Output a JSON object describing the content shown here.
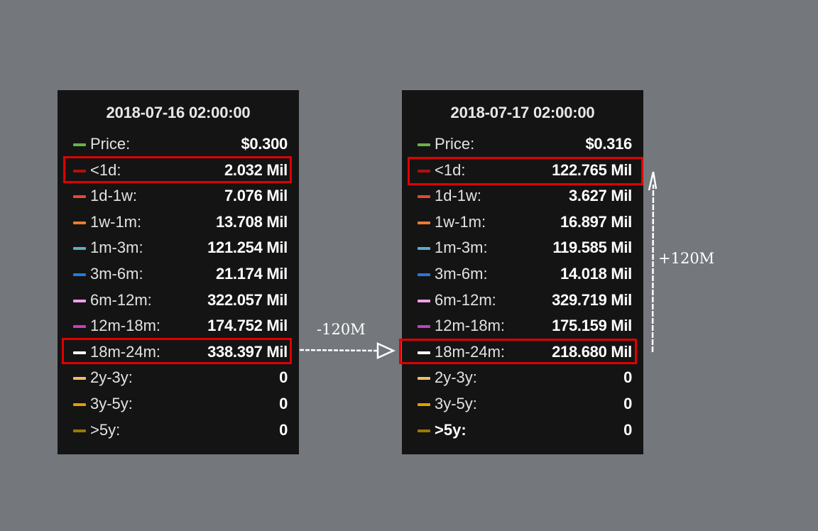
{
  "panels": [
    {
      "title": "2018-07-16 02:00:00",
      "rows": [
        {
          "label": "Price:",
          "value": "$0.300",
          "color": "#6ab04c"
        },
        {
          "label": "<1d:",
          "value": "2.032 Mil",
          "color": "#b01010"
        },
        {
          "label": "1d-1w:",
          "value": "7.076 Mil",
          "color": "#e04a3a"
        },
        {
          "label": "1w-1m:",
          "value": "13.708 Mil",
          "color": "#f07830"
        },
        {
          "label": "1m-3m:",
          "value": "121.254 Mil",
          "color": "#5aaed0"
        },
        {
          "label": "3m-6m:",
          "value": "21.174 Mil",
          "color": "#2a78d8"
        },
        {
          "label": "6m-12m:",
          "value": "322.057 Mil",
          "color": "#f0a0e8"
        },
        {
          "label": "12m-18m:",
          "value": "174.752 Mil",
          "color": "#c040c0"
        },
        {
          "label": "18m-24m:",
          "value": "338.397 Mil",
          "color": "#ffffff"
        },
        {
          "label": "2y-3y:",
          "value": "0",
          "color": "#f0c060"
        },
        {
          "label": "3y-5y:",
          "value": "0",
          "color": "#e0a000"
        },
        {
          "label": ">5y:",
          "value": "0",
          "color": "#9c7a00"
        }
      ]
    },
    {
      "title": "2018-07-17 02:00:00",
      "rows": [
        {
          "label": "Price:",
          "value": "$0.316",
          "color": "#6ab04c"
        },
        {
          "label": "<1d:",
          "value": "122.765 Mil",
          "color": "#b01010"
        },
        {
          "label": "1d-1w:",
          "value": "3.627 Mil",
          "color": "#e04a3a"
        },
        {
          "label": "1w-1m:",
          "value": "16.897 Mil",
          "color": "#f07830"
        },
        {
          "label": "1m-3m:",
          "value": "119.585 Mil",
          "color": "#5aaed0"
        },
        {
          "label": "3m-6m:",
          "value": "14.018 Mil",
          "color": "#2a78d8"
        },
        {
          "label": "6m-12m:",
          "value": "329.719 Mil",
          "color": "#f0a0e8"
        },
        {
          "label": "12m-18m:",
          "value": "175.159 Mil",
          "color": "#c040c0"
        },
        {
          "label": "18m-24m:",
          "value": "218.680 Mil",
          "color": "#ffffff"
        },
        {
          "label": "2y-3y:",
          "value": "0",
          "color": "#f0c060"
        },
        {
          "label": "3y-5y:",
          "value": "0",
          "color": "#e0a000"
        },
        {
          "label": ">5y:",
          "value": "0",
          "color": "#9c7a00"
        }
      ]
    }
  ],
  "annotations": {
    "decrease_label": "-120M",
    "increase_label": "+120M"
  },
  "colors": {
    "background": "#74777c",
    "panel": "#141414",
    "highlight": "#e00000"
  }
}
